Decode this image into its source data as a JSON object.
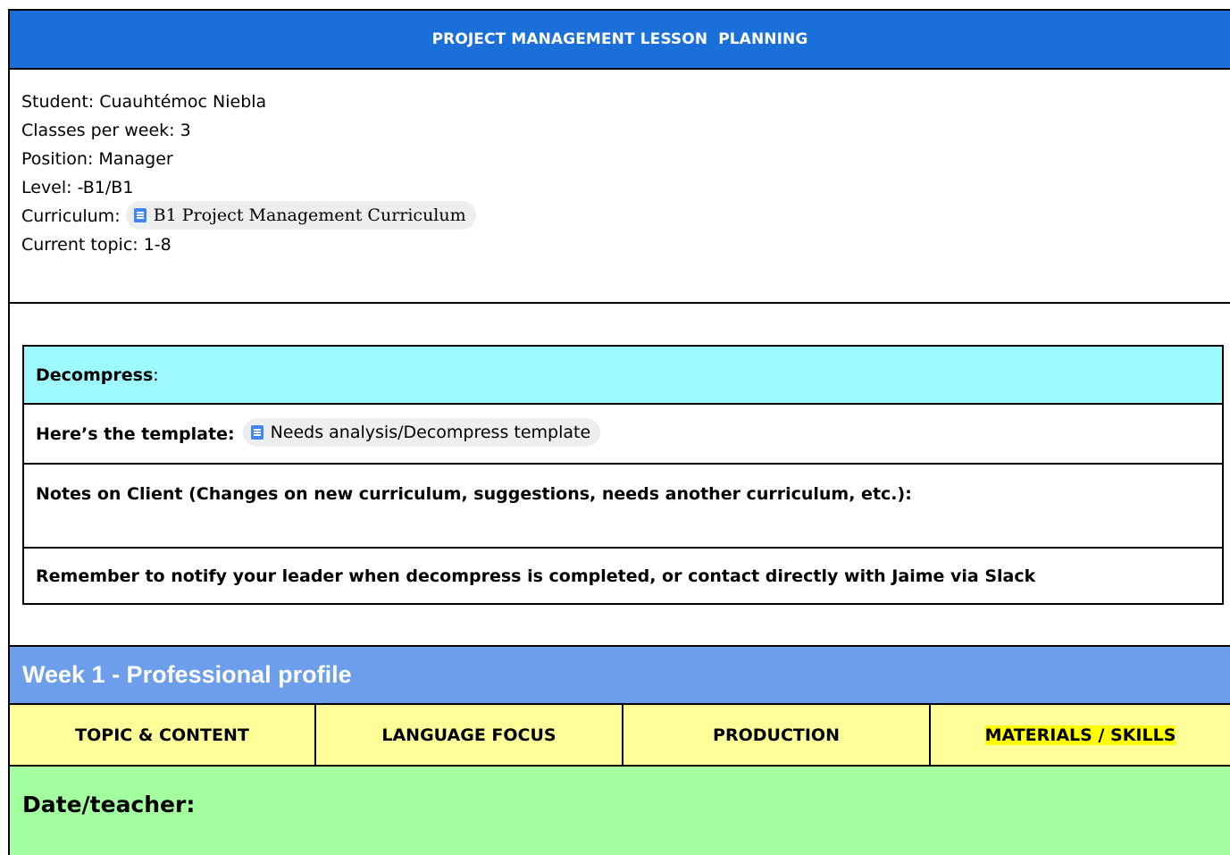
{
  "title": "PROJECT MANAGEMENT LESSON  PLANNING",
  "student_info": {
    "student": "Student: Cuauhtémoc Niebla",
    "classes": "Classes per week: 3",
    "position": "Position: Manager",
    "level": "Level: -B1/B1",
    "curriculum_label": "Curriculum: ",
    "curriculum_link": "B1 Project Management Curriculum",
    "current_topic": "Current topic: 1-8"
  },
  "decompress": {
    "heading": "Decompress",
    "heading_suffix": ":",
    "template_label": "Here’s the template:",
    "template_link": "Needs analysis/Decompress template",
    "notes": "Notes on Client (Changes on new curriculum, suggestions, needs another curriculum, etc.):",
    "reminder": "Remember to notify your leader when decompress is completed, or contact directly with Jaime via Slack"
  },
  "week": {
    "title": "Week 1 - Professional profile",
    "columns": [
      "TOPIC & CONTENT",
      "LANGUAGE FOCUS",
      "PRODUCTION",
      "MATERIALS / SKILLS"
    ],
    "date_teacher": "Date/teacher:"
  },
  "colors": {
    "title_bar": "#1b6fd9",
    "decompress_header": "#9ef9ff",
    "week_bar": "#6d9eeb",
    "column_header": "#ffff99",
    "materials_highlight": "#ffff00",
    "date_row": "#a3fea0",
    "link_chip": "#eceef0",
    "doc_icon": "#4285f4"
  },
  "icons": {
    "curriculum_link": "google-doc-icon",
    "template_link": "google-doc-icon"
  }
}
